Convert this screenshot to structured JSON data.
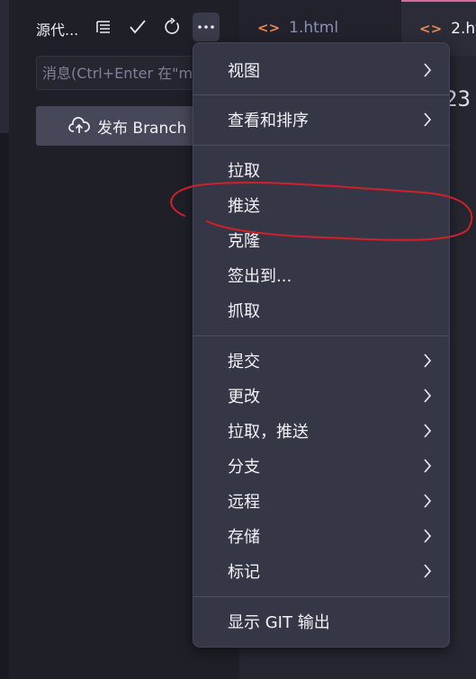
{
  "scm": {
    "title": "源代...",
    "message_placeholder": "消息(Ctrl+Enter 在\"m",
    "publish_label": "发布 Branch"
  },
  "tabs": [
    {
      "label": "1.html"
    },
    {
      "label": "2.htm"
    }
  ],
  "editor": {
    "visible_text": "23"
  },
  "menu": {
    "items": [
      {
        "label": "视图",
        "submenu": true
      },
      {
        "label": "查看和排序",
        "submenu": true
      },
      {
        "label": "拉取",
        "submenu": false
      },
      {
        "label": "推送",
        "submenu": false
      },
      {
        "label": "克隆",
        "submenu": false
      },
      {
        "label": "签出到...",
        "submenu": false
      },
      {
        "label": "抓取",
        "submenu": false
      },
      {
        "label": "提交",
        "submenu": true
      },
      {
        "label": "更改",
        "submenu": true
      },
      {
        "label": "拉取，推送",
        "submenu": true
      },
      {
        "label": "分支",
        "submenu": true
      },
      {
        "label": "远程",
        "submenu": true
      },
      {
        "label": "存储",
        "submenu": true
      },
      {
        "label": "标记",
        "submenu": true
      },
      {
        "label": "显示 GIT 输出",
        "submenu": false
      }
    ]
  },
  "colors": {
    "annotation": "#d0202a",
    "tab_file_icon": "#e8874f",
    "active_tab_border": "#d46a9a"
  },
  "icons": [
    "tree-view-icon",
    "checkmark-icon",
    "refresh-icon",
    "more-actions-icon",
    "cloud-upload-icon",
    "chevron-right-icon",
    "code-file-icon"
  ]
}
